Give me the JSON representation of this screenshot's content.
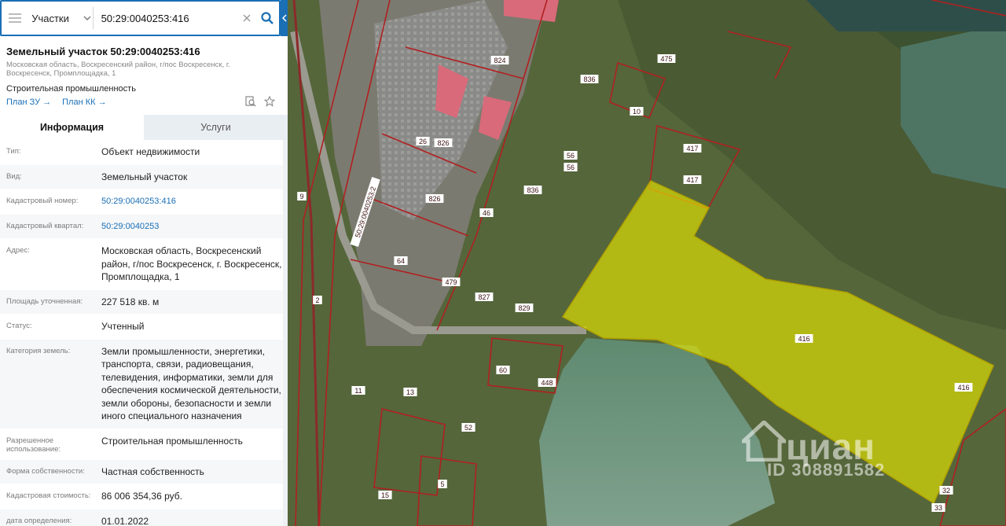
{
  "search": {
    "layer": "Участки",
    "query": "50:29:0040253:416",
    "icons": {
      "menu": "hamburger-icon",
      "chevron": "chevron-down-icon",
      "clear": "close-icon",
      "search": "search-icon",
      "collapse": "chevron-left-icon"
    }
  },
  "header": {
    "title": "Земельный участок 50:29:0040253:416",
    "address": "Московская область, Воскресенский район, г/пос Воскресенск, г. Воскресенск, Промплощадка, 1",
    "purpose": "Строительная промышленность",
    "links": [
      "План ЗУ →",
      "План КК →"
    ]
  },
  "tabs": [
    "Информация",
    "Услуги"
  ],
  "info": [
    {
      "k": "Тип:",
      "v": "Объект недвижимости"
    },
    {
      "k": "Вид:",
      "v": "Земельный участок"
    },
    {
      "k": "Кадастровый номер:",
      "v": "50:29:0040253:416",
      "link": true
    },
    {
      "k": "Кадастровый квартал:",
      "v": "50:29:0040253",
      "link": true
    },
    {
      "k": "Адрес:",
      "v": "Московская область, Воскресенский район, г/пос Воскресенск, г. Воскресенск, Промплощадка, 1"
    },
    {
      "k": "Площадь уточненная:",
      "v": "227 518 кв. м"
    },
    {
      "k": "Статус:",
      "v": "Учтенный"
    },
    {
      "k": "Категория земель:",
      "v": "Земли промышленности, энергетики, транспорта, связи, радиовещания, телевидения, информатики, земли для обеспечения космической деятельности, земли обороны, безопасности и земли иного специального назначения"
    },
    {
      "k": "Разрешенное использование:",
      "v": "Строительная промышленность"
    },
    {
      "k": "Форма собственности:",
      "v": "Частная собственность"
    },
    {
      "k": "Кадастровая стоимость:",
      "v": "86 006 354,36 руб."
    },
    {
      "k": "дата определения:",
      "v": "01.01.2022"
    }
  ],
  "map": {
    "highlight_color": "#e6e600",
    "boundary_color": "#b02020",
    "plot_labels": [
      "417",
      "417",
      "416",
      "416",
      "475",
      "836",
      "10",
      "824",
      "56",
      "56",
      "836",
      "26",
      "826",
      "826",
      "46",
      "64",
      "479",
      "827",
      "829",
      "2",
      "9",
      "60",
      "448",
      "11",
      "13",
      "52",
      "5",
      "15",
      "33",
      "32",
      "50:29:0040253:2"
    ],
    "watermark": {
      "brand": "циан",
      "id": "ID 308891582"
    }
  }
}
